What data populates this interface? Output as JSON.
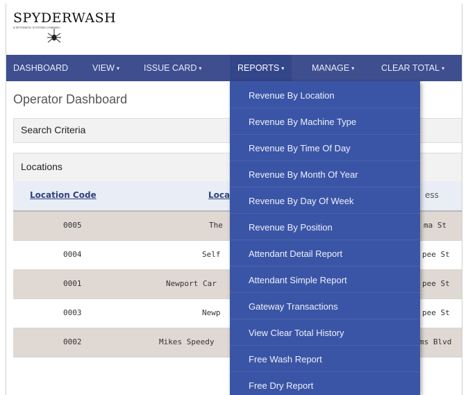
{
  "logo": {
    "wordmark": "SPYDERWASH",
    "tagline": "A SETOMATIC SYSTEMS COMPANY"
  },
  "navbar": {
    "items": [
      {
        "label": "DASHBOARD",
        "caret": ""
      },
      {
        "label": "VIEW",
        "caret": "▾"
      },
      {
        "label": "ISSUE CARD",
        "caret": "▾"
      },
      {
        "label": "REPORTS",
        "caret": "▾"
      },
      {
        "label": "MANAGE",
        "caret": "▾"
      },
      {
        "label": "CLEAR TOTAL",
        "caret": "▾"
      }
    ]
  },
  "page": {
    "title": "Operator Dashboard",
    "search_panel": "Search Criteria",
    "locations_panel": "Locations"
  },
  "table": {
    "headers": [
      "Location Code",
      "Loca",
      "ess"
    ],
    "rows": [
      {
        "code": "0005",
        "name": "The",
        "address": "ma St"
      },
      {
        "code": "0004",
        "name": "Self",
        "address": "pee St"
      },
      {
        "code": "0001",
        "name": "Newport Car",
        "address": "pee St"
      },
      {
        "code": "0003",
        "name": "Newp",
        "address": "pee St"
      },
      {
        "code": "0002",
        "name": "Mikes Speedy",
        "address": "ms Blvd"
      }
    ]
  },
  "reports_menu": {
    "items": [
      "Revenue By Location",
      "Revenue By Machine Type",
      "Revenue By Time Of Day",
      "Revenue By Month Of Year",
      "Revenue By Day Of Week",
      "Revenue By Position",
      "Attendant Detail Report",
      "Attendant Simple Report",
      "Gateway Transactions",
      "View Clear Total History",
      "Free Wash Report",
      "Free Dry Report"
    ]
  },
  "colors": {
    "navbar": "#3e4e8f",
    "dropdown": "#3b55a6",
    "shaded_row": "#e0d9d3",
    "header_link": "#2f3f7f"
  }
}
